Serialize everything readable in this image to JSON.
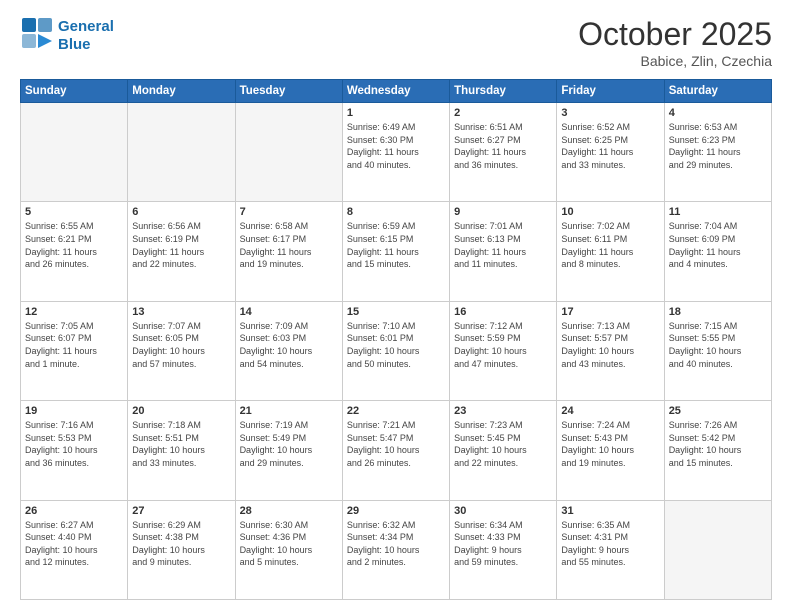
{
  "header": {
    "logo_line1": "General",
    "logo_line2": "Blue",
    "month_title": "October 2025",
    "location": "Babice, Zlin, Czechia"
  },
  "days_of_week": [
    "Sunday",
    "Monday",
    "Tuesday",
    "Wednesday",
    "Thursday",
    "Friday",
    "Saturday"
  ],
  "weeks": [
    [
      {
        "day": "",
        "info": ""
      },
      {
        "day": "",
        "info": ""
      },
      {
        "day": "",
        "info": ""
      },
      {
        "day": "1",
        "info": "Sunrise: 6:49 AM\nSunset: 6:30 PM\nDaylight: 11 hours\nand 40 minutes."
      },
      {
        "day": "2",
        "info": "Sunrise: 6:51 AM\nSunset: 6:27 PM\nDaylight: 11 hours\nand 36 minutes."
      },
      {
        "day": "3",
        "info": "Sunrise: 6:52 AM\nSunset: 6:25 PM\nDaylight: 11 hours\nand 33 minutes."
      },
      {
        "day": "4",
        "info": "Sunrise: 6:53 AM\nSunset: 6:23 PM\nDaylight: 11 hours\nand 29 minutes."
      }
    ],
    [
      {
        "day": "5",
        "info": "Sunrise: 6:55 AM\nSunset: 6:21 PM\nDaylight: 11 hours\nand 26 minutes."
      },
      {
        "day": "6",
        "info": "Sunrise: 6:56 AM\nSunset: 6:19 PM\nDaylight: 11 hours\nand 22 minutes."
      },
      {
        "day": "7",
        "info": "Sunrise: 6:58 AM\nSunset: 6:17 PM\nDaylight: 11 hours\nand 19 minutes."
      },
      {
        "day": "8",
        "info": "Sunrise: 6:59 AM\nSunset: 6:15 PM\nDaylight: 11 hours\nand 15 minutes."
      },
      {
        "day": "9",
        "info": "Sunrise: 7:01 AM\nSunset: 6:13 PM\nDaylight: 11 hours\nand 11 minutes."
      },
      {
        "day": "10",
        "info": "Sunrise: 7:02 AM\nSunset: 6:11 PM\nDaylight: 11 hours\nand 8 minutes."
      },
      {
        "day": "11",
        "info": "Sunrise: 7:04 AM\nSunset: 6:09 PM\nDaylight: 11 hours\nand 4 minutes."
      }
    ],
    [
      {
        "day": "12",
        "info": "Sunrise: 7:05 AM\nSunset: 6:07 PM\nDaylight: 11 hours\nand 1 minute."
      },
      {
        "day": "13",
        "info": "Sunrise: 7:07 AM\nSunset: 6:05 PM\nDaylight: 10 hours\nand 57 minutes."
      },
      {
        "day": "14",
        "info": "Sunrise: 7:09 AM\nSunset: 6:03 PM\nDaylight: 10 hours\nand 54 minutes."
      },
      {
        "day": "15",
        "info": "Sunrise: 7:10 AM\nSunset: 6:01 PM\nDaylight: 10 hours\nand 50 minutes."
      },
      {
        "day": "16",
        "info": "Sunrise: 7:12 AM\nSunset: 5:59 PM\nDaylight: 10 hours\nand 47 minutes."
      },
      {
        "day": "17",
        "info": "Sunrise: 7:13 AM\nSunset: 5:57 PM\nDaylight: 10 hours\nand 43 minutes."
      },
      {
        "day": "18",
        "info": "Sunrise: 7:15 AM\nSunset: 5:55 PM\nDaylight: 10 hours\nand 40 minutes."
      }
    ],
    [
      {
        "day": "19",
        "info": "Sunrise: 7:16 AM\nSunset: 5:53 PM\nDaylight: 10 hours\nand 36 minutes."
      },
      {
        "day": "20",
        "info": "Sunrise: 7:18 AM\nSunset: 5:51 PM\nDaylight: 10 hours\nand 33 minutes."
      },
      {
        "day": "21",
        "info": "Sunrise: 7:19 AM\nSunset: 5:49 PM\nDaylight: 10 hours\nand 29 minutes."
      },
      {
        "day": "22",
        "info": "Sunrise: 7:21 AM\nSunset: 5:47 PM\nDaylight: 10 hours\nand 26 minutes."
      },
      {
        "day": "23",
        "info": "Sunrise: 7:23 AM\nSunset: 5:45 PM\nDaylight: 10 hours\nand 22 minutes."
      },
      {
        "day": "24",
        "info": "Sunrise: 7:24 AM\nSunset: 5:43 PM\nDaylight: 10 hours\nand 19 minutes."
      },
      {
        "day": "25",
        "info": "Sunrise: 7:26 AM\nSunset: 5:42 PM\nDaylight: 10 hours\nand 15 minutes."
      }
    ],
    [
      {
        "day": "26",
        "info": "Sunrise: 6:27 AM\nSunset: 4:40 PM\nDaylight: 10 hours\nand 12 minutes."
      },
      {
        "day": "27",
        "info": "Sunrise: 6:29 AM\nSunset: 4:38 PM\nDaylight: 10 hours\nand 9 minutes."
      },
      {
        "day": "28",
        "info": "Sunrise: 6:30 AM\nSunset: 4:36 PM\nDaylight: 10 hours\nand 5 minutes."
      },
      {
        "day": "29",
        "info": "Sunrise: 6:32 AM\nSunset: 4:34 PM\nDaylight: 10 hours\nand 2 minutes."
      },
      {
        "day": "30",
        "info": "Sunrise: 6:34 AM\nSunset: 4:33 PM\nDaylight: 9 hours\nand 59 minutes."
      },
      {
        "day": "31",
        "info": "Sunrise: 6:35 AM\nSunset: 4:31 PM\nDaylight: 9 hours\nand 55 minutes."
      },
      {
        "day": "",
        "info": ""
      }
    ]
  ]
}
